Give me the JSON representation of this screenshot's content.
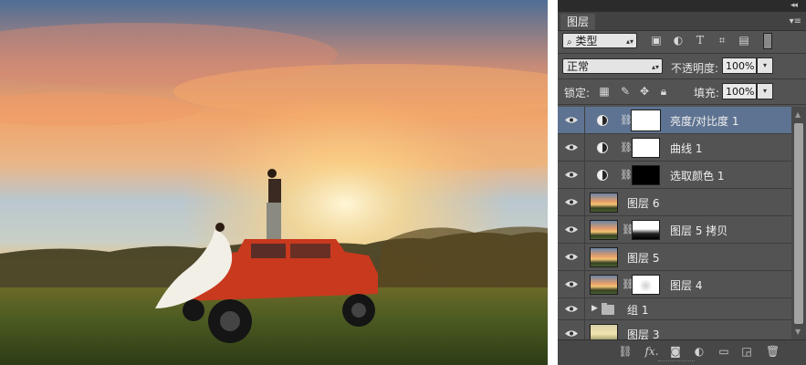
{
  "panel": {
    "tab_label": "图层",
    "filter": {
      "kind_label": "类型",
      "search_icon": "search-icon"
    },
    "blend_mode": "正常",
    "opacity_label": "不透明度:",
    "opacity_value": "100%",
    "lock_label": "锁定:",
    "fill_label": "填充:",
    "fill_value": "100%",
    "layers": [
      {
        "name": "亮度/对比度 1",
        "type": "adjustment",
        "selected": true
      },
      {
        "name": "曲线 1",
        "type": "adjustment",
        "selected": false
      },
      {
        "name": "选取颜色 1",
        "type": "adjustment",
        "selected": false
      },
      {
        "name": "图层 6",
        "type": "pixel",
        "selected": false
      },
      {
        "name": "图层 5 拷贝",
        "type": "pixel-mask",
        "selected": false
      },
      {
        "name": "图层 5",
        "type": "pixel",
        "selected": false
      },
      {
        "name": "图层 4",
        "type": "pixel-mask",
        "selected": false
      },
      {
        "name": "组 1",
        "type": "group",
        "selected": false
      },
      {
        "name": "图层 3",
        "type": "pixel",
        "selected": false
      }
    ],
    "bottom_icons": [
      "link-layers-icon",
      "fx-icon",
      "add-mask-icon",
      "adjustment-layer-icon",
      "new-group-icon",
      "new-layer-icon",
      "trash-icon"
    ],
    "fx_label": "fx.",
    "text_tool_glyph": "T"
  },
  "colors": {
    "panel_bg": "#535353",
    "selected_row": "#5e7391"
  }
}
